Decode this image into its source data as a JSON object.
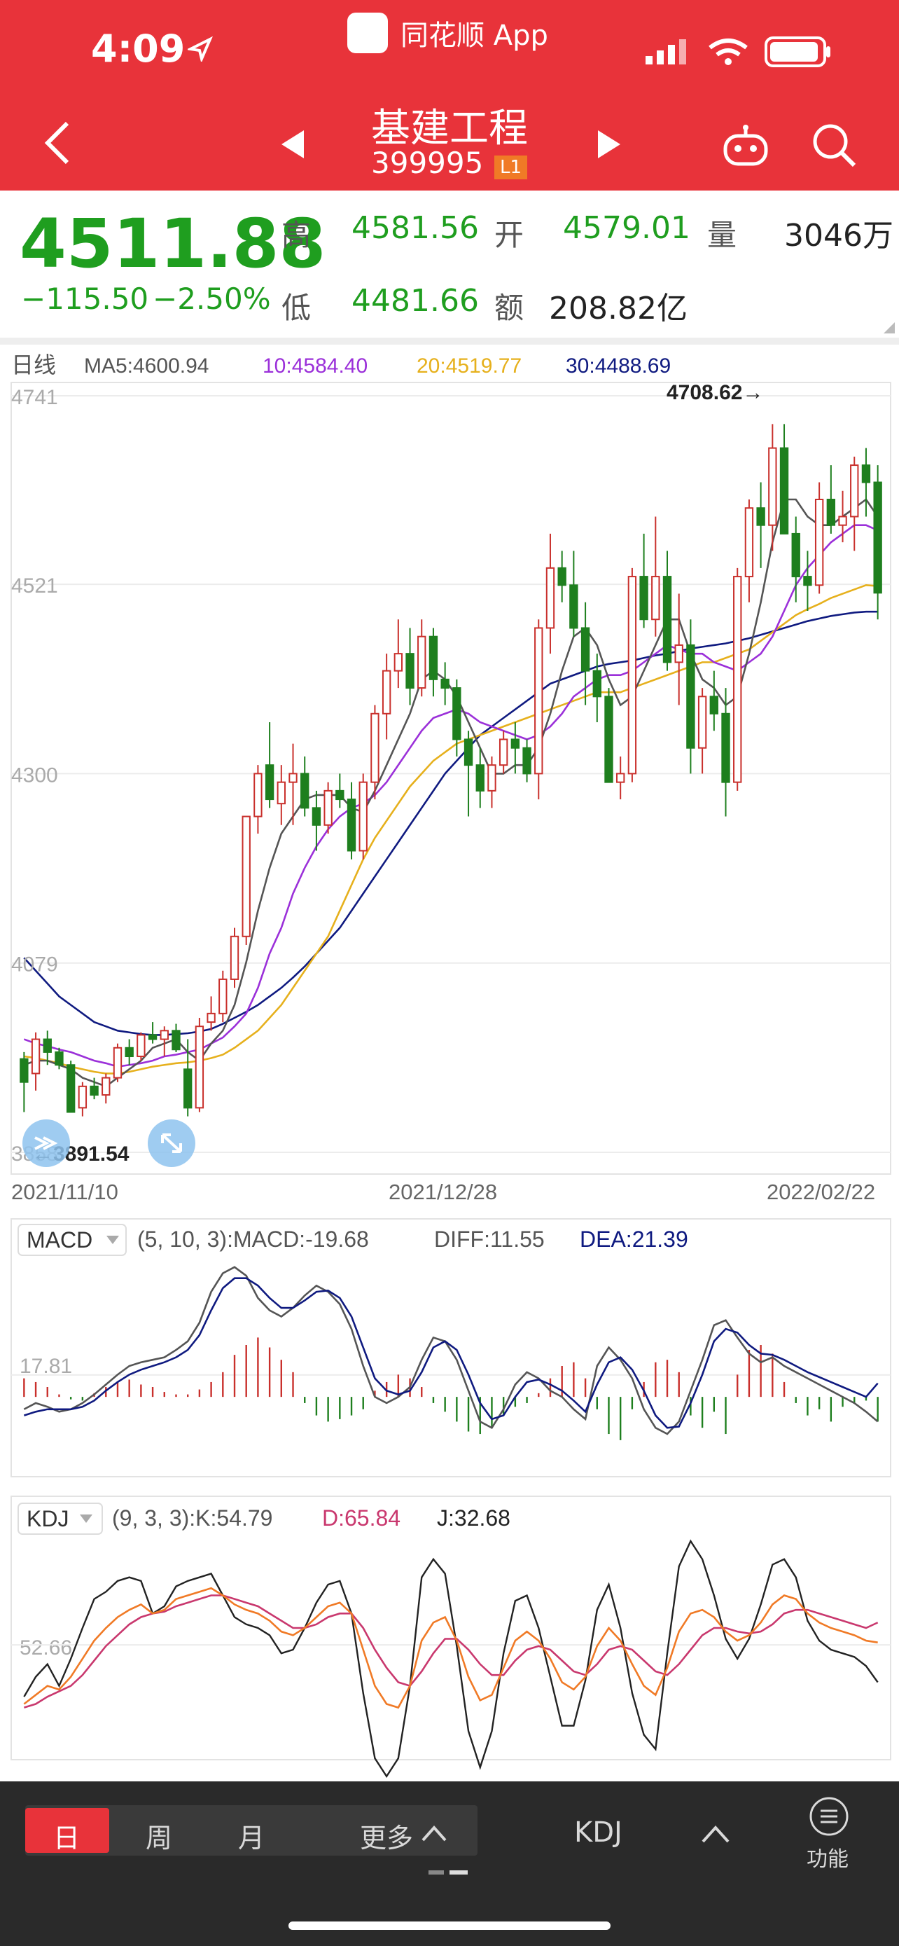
{
  "status": {
    "time": "4:09"
  },
  "app": {
    "name": "同花顺 App"
  },
  "nav": {
    "title": "基建工程",
    "code": "399995",
    "badge": "L1"
  },
  "quote": {
    "price": "4511.88",
    "change": "−115.50",
    "change_pct": "−2.50%",
    "high_label": "高",
    "high": "4581.56",
    "open_label": "开",
    "open": "4579.01",
    "volume_label": "量",
    "volume": "3046万",
    "low_label": "低",
    "low": "4481.66",
    "amount_label": "额",
    "amount": "208.82亿"
  },
  "colors": {
    "up": "#c9302c",
    "down": "#1e7f1e",
    "ma5": "#555555",
    "ma10": "#9b30d9",
    "ma20": "#e6b01c",
    "ma30": "#0f1a80",
    "brand": "#e8333a"
  },
  "ma_legend": {
    "period": "日线",
    "ma5": "MA5:4600.94",
    "ma10": "10:4584.40",
    "ma20": "20:4519.77",
    "ma30": "30:4488.69"
  },
  "chart_data": [
    {
      "type": "candlestick",
      "title": "基建工程",
      "y_ticks": [
        "4741",
        "4521",
        "4300",
        "4079",
        "3858"
      ],
      "ylim": [
        3858,
        4741
      ],
      "x_ticks": [
        "2021/11/10",
        "2021/12/28",
        "2022/02/22"
      ],
      "max_annotation": "4708.62→",
      "min_annotation": "←3891.54",
      "grid": true,
      "candles": [
        [
          3967,
          3975,
          3905,
          3940
        ],
        [
          3950,
          3998,
          3930,
          3990
        ],
        [
          3990,
          4000,
          3960,
          3975
        ],
        [
          3975,
          3980,
          3955,
          3960
        ],
        [
          3960,
          3965,
          3910,
          3905
        ],
        [
          3910,
          3940,
          3900,
          3935
        ],
        [
          3935,
          3945,
          3920,
          3925
        ],
        [
          3925,
          3950,
          3915,
          3945
        ],
        [
          3945,
          3985,
          3940,
          3980
        ],
        [
          3980,
          3990,
          3960,
          3970
        ],
        [
          3970,
          3998,
          3965,
          3995
        ],
        [
          3995,
          4010,
          3985,
          3990
        ],
        [
          3990,
          4005,
          3970,
          4000
        ],
        [
          4000,
          4008,
          3975,
          3978
        ],
        [
          3955,
          3990,
          3900,
          3910
        ],
        [
          3910,
          4015,
          3905,
          4005
        ],
        [
          4010,
          4040,
          4000,
          4020
        ],
        [
          4020,
          4070,
          4010,
          4060
        ],
        [
          4060,
          4120,
          4050,
          4110
        ],
        [
          4110,
          4230,
          4100,
          4250
        ],
        [
          4250,
          4310,
          4230,
          4300
        ],
        [
          4310,
          4360,
          4260,
          4270
        ],
        [
          4265,
          4310,
          4240,
          4290
        ],
        [
          4290,
          4335,
          4240,
          4300
        ],
        [
          4300,
          4320,
          4250,
          4260
        ],
        [
          4260,
          4280,
          4210,
          4240
        ],
        [
          4240,
          4290,
          4230,
          4280
        ],
        [
          4280,
          4300,
          4260,
          4270
        ],
        [
          4270,
          4290,
          4200,
          4210
        ],
        [
          4210,
          4300,
          4200,
          4290
        ],
        [
          4290,
          4380,
          4270,
          4370
        ],
        [
          4370,
          4440,
          4340,
          4420
        ],
        [
          4420,
          4480,
          4400,
          4440
        ],
        [
          4440,
          4470,
          4380,
          4400
        ],
        [
          4400,
          4480,
          4390,
          4460
        ],
        [
          4460,
          4470,
          4390,
          4410
        ],
        [
          4410,
          4430,
          4380,
          4400
        ],
        [
          4400,
          4410,
          4320,
          4340
        ],
        [
          4340,
          4350,
          4250,
          4310
        ],
        [
          4310,
          4330,
          4260,
          4280
        ],
        [
          4280,
          4320,
          4260,
          4310
        ],
        [
          4310,
          4350,
          4300,
          4340
        ],
        [
          4340,
          4360,
          4300,
          4330
        ],
        [
          4330,
          4340,
          4290,
          4300
        ],
        [
          4300,
          4480,
          4270,
          4470
        ],
        [
          4470,
          4580,
          4440,
          4540
        ],
        [
          4540,
          4560,
          4500,
          4520
        ],
        [
          4520,
          4560,
          4460,
          4470
        ],
        [
          4470,
          4500,
          4380,
          4420
        ],
        [
          4420,
          4440,
          4360,
          4390
        ],
        [
          4390,
          4400,
          4300,
          4290
        ],
        [
          4290,
          4320,
          4270,
          4300
        ],
        [
          4300,
          4540,
          4290,
          4530
        ],
        [
          4530,
          4580,
          4470,
          4480
        ],
        [
          4480,
          4600,
          4460,
          4530
        ],
        [
          4530,
          4560,
          4420,
          4430
        ],
        [
          4430,
          4510,
          4380,
          4450
        ],
        [
          4450,
          4480,
          4300,
          4330
        ],
        [
          4330,
          4400,
          4300,
          4390
        ],
        [
          4390,
          4420,
          4350,
          4370
        ],
        [
          4370,
          4400,
          4250,
          4290
        ],
        [
          4290,
          4540,
          4280,
          4530
        ],
        [
          4530,
          4620,
          4500,
          4610
        ],
        [
          4610,
          4640,
          4540,
          4590
        ],
        [
          4590,
          4708,
          4560,
          4680
        ],
        [
          4680,
          4708,
          4580,
          4580
        ],
        [
          4580,
          4600,
          4500,
          4530
        ],
        [
          4530,
          4560,
          4490,
          4520
        ],
        [
          4520,
          4640,
          4510,
          4620
        ],
        [
          4620,
          4660,
          4580,
          4590
        ],
        [
          4590,
          4630,
          4570,
          4600
        ],
        [
          4600,
          4670,
          4560,
          4660
        ],
        [
          4660,
          4680,
          4600,
          4640
        ],
        [
          4640,
          4660,
          4480,
          4511
        ]
      ],
      "ma5": [
        3960,
        3965,
        3965,
        3960,
        3955,
        3945,
        3940,
        3935,
        3945,
        3955,
        3965,
        3980,
        3985,
        3990,
        3975,
        3965,
        3985,
        4000,
        4030,
        4080,
        4140,
        4190,
        4230,
        4250,
        4270,
        4275,
        4275,
        4275,
        4260,
        4255,
        4280,
        4310,
        4340,
        4370,
        4410,
        4420,
        4410,
        4390,
        4360,
        4330,
        4300,
        4300,
        4310,
        4310,
        4330,
        4370,
        4420,
        4460,
        4470,
        4450,
        4410,
        4380,
        4390,
        4420,
        4450,
        4480,
        4480,
        4440,
        4410,
        4400,
        4380,
        4390,
        4440,
        4500,
        4570,
        4620,
        4620,
        4600,
        4590,
        4590,
        4600,
        4610,
        4620,
        4600
      ],
      "ma10": [
        3990,
        3985,
        3982,
        3978,
        3975,
        3970,
        3965,
        3962,
        3958,
        3960,
        3962,
        3965,
        3970,
        3972,
        3975,
        3978,
        3985,
        3992,
        4005,
        4020,
        4050,
        4090,
        4120,
        4160,
        4190,
        4215,
        4235,
        4250,
        4260,
        4265,
        4275,
        4290,
        4310,
        4330,
        4350,
        4365,
        4370,
        4375,
        4370,
        4360,
        4355,
        4350,
        4345,
        4340,
        4345,
        4355,
        4370,
        4390,
        4400,
        4410,
        4415,
        4415,
        4420,
        4430,
        4440,
        4450,
        4445,
        4440,
        4440,
        4430,
        4425,
        4420,
        4430,
        4440,
        4460,
        4490,
        4520,
        4540,
        4555,
        4570,
        4580,
        4590,
        4590,
        4584
      ],
      "ma20": [
        3970,
        3968,
        3965,
        3962,
        3958,
        3955,
        3952,
        3950,
        3950,
        3952,
        3955,
        3958,
        3960,
        3962,
        3963,
        3965,
        3968,
        3972,
        3980,
        3990,
        4000,
        4015,
        4030,
        4050,
        4070,
        4090,
        4110,
        4140,
        4170,
        4200,
        4225,
        4245,
        4265,
        4285,
        4300,
        4315,
        4325,
        4335,
        4340,
        4345,
        4350,
        4355,
        4360,
        4365,
        4370,
        4375,
        4380,
        4385,
        4390,
        4395,
        4395,
        4395,
        4400,
        4405,
        4410,
        4415,
        4420,
        4425,
        4430,
        4430,
        4435,
        4440,
        4445,
        4455,
        4465,
        4475,
        4485,
        4492,
        4498,
        4505,
        4510,
        4515,
        4520,
        4519
      ],
      "ma30": [
        4085,
        4070,
        4055,
        4040,
        4030,
        4020,
        4010,
        4005,
        4000,
        3998,
        3996,
        3995,
        3995,
        3996,
        3997,
        3999,
        4002,
        4008,
        4015,
        4022,
        4030,
        4040,
        4050,
        4062,
        4075,
        4090,
        4105,
        4120,
        4140,
        4160,
        4180,
        4200,
        4220,
        4240,
        4260,
        4280,
        4300,
        4315,
        4330,
        4345,
        4355,
        4365,
        4375,
        4385,
        4395,
        4405,
        4410,
        4415,
        4420,
        4425,
        4428,
        4430,
        4432,
        4435,
        4438,
        4440,
        4443,
        4446,
        4448,
        4450,
        4452,
        4455,
        4458,
        4462,
        4466,
        4470,
        4474,
        4478,
        4481,
        4484,
        4486,
        4488,
        4489,
        4489
      ]
    },
    {
      "type": "bar",
      "title": "MACD",
      "params": "(5, 10, 3):MACD:-19.68",
      "diff_label": "DIFF:11.55",
      "dea_label": "DEA:21.39",
      "indicator_label": "MACD",
      "ref_tick": "17.81",
      "ylim": [
        -60,
        110
      ],
      "hist": [
        15,
        12,
        8,
        2,
        -2,
        -3,
        3,
        8,
        12,
        14,
        10,
        8,
        4,
        2,
        2,
        6,
        12,
        20,
        34,
        42,
        48,
        40,
        30,
        20,
        -5,
        -15,
        -20,
        -18,
        -15,
        -10,
        5,
        12,
        18,
        15,
        8,
        -5,
        -12,
        -20,
        -28,
        -30,
        -25,
        -15,
        -8,
        -5,
        3,
        15,
        25,
        28,
        15,
        -10,
        -30,
        -35,
        -10,
        12,
        28,
        30,
        20,
        -15,
        -25,
        -12,
        -30,
        18,
        38,
        42,
        35,
        12,
        -5,
        -15,
        -10,
        -20,
        -8,
        -5,
        -3,
        -20
      ],
      "diff": [
        -10,
        -5,
        -8,
        -12,
        -10,
        -5,
        2,
        10,
        18,
        25,
        28,
        30,
        32,
        38,
        45,
        60,
        85,
        100,
        105,
        98,
        80,
        70,
        65,
        72,
        82,
        90,
        85,
        75,
        55,
        25,
        0,
        -5,
        0,
        8,
        30,
        48,
        45,
        30,
        5,
        -20,
        -25,
        -10,
        10,
        20,
        15,
        5,
        0,
        -10,
        -18,
        25,
        40,
        30,
        15,
        -10,
        -25,
        -30,
        -20,
        5,
        30,
        58,
        62,
        48,
        35,
        28,
        32,
        25,
        20,
        15,
        10,
        5,
        0,
        -5,
        -12,
        -20
      ],
      "dea": [
        -15,
        -12,
        -10,
        -10,
        -10,
        -8,
        -3,
        5,
        12,
        18,
        22,
        25,
        28,
        32,
        38,
        50,
        70,
        88,
        96,
        96,
        90,
        80,
        72,
        72,
        78,
        85,
        86,
        80,
        65,
        40,
        15,
        5,
        2,
        5,
        20,
        40,
        45,
        38,
        18,
        -5,
        -18,
        -15,
        0,
        12,
        14,
        10,
        5,
        -3,
        -12,
        10,
        28,
        32,
        22,
        5,
        -15,
        -25,
        -24,
        -5,
        18,
        45,
        55,
        52,
        42,
        35,
        34,
        30,
        25,
        20,
        16,
        12,
        8,
        4,
        0,
        11
      ]
    },
    {
      "type": "line",
      "title": "KDJ",
      "params": "(9, 3, 3):K:54.79",
      "d_label": "D:65.84",
      "j_label": "J:32.68",
      "indicator_label": "KDJ",
      "ref_tick": "52.66",
      "ylim": [
        -10,
        110
      ],
      "k": [
        20,
        25,
        30,
        28,
        35,
        45,
        55,
        62,
        68,
        72,
        75,
        70,
        72,
        78,
        80,
        82,
        84,
        80,
        75,
        72,
        70,
        66,
        60,
        58,
        62,
        68,
        74,
        76,
        70,
        50,
        30,
        20,
        18,
        30,
        55,
        65,
        68,
        55,
        35,
        22,
        25,
        40,
        55,
        60,
        55,
        45,
        32,
        28,
        35,
        52,
        62,
        55,
        42,
        30,
        25,
        40,
        60,
        70,
        72,
        68,
        60,
        55,
        58,
        65,
        75,
        80,
        78,
        70,
        65,
        62,
        60,
        58,
        55,
        54
      ],
      "d": [
        18,
        20,
        24,
        27,
        30,
        36,
        44,
        52,
        58,
        64,
        68,
        70,
        71,
        74,
        76,
        78,
        80,
        80,
        78,
        76,
        74,
        70,
        66,
        62,
        62,
        64,
        68,
        70,
        70,
        62,
        50,
        40,
        32,
        30,
        38,
        48,
        56,
        56,
        50,
        42,
        36,
        36,
        44,
        50,
        52,
        50,
        44,
        38,
        36,
        42,
        50,
        52,
        50,
        44,
        38,
        36,
        42,
        50,
        58,
        62,
        62,
        60,
        59,
        60,
        64,
        70,
        72,
        72,
        70,
        68,
        66,
        64,
        62,
        65
      ],
      "j": [
        24,
        35,
        42,
        30,
        45,
        62,
        78,
        82,
        88,
        90,
        88,
        70,
        74,
        85,
        88,
        90,
        92,
        80,
        68,
        64,
        62,
        58,
        48,
        50,
        62,
        76,
        86,
        88,
        70,
        26,
        -10,
        -20,
        -10,
        30,
        90,
        100,
        92,
        52,
        5,
        -15,
        5,
        48,
        77,
        80,
        62,
        35,
        8,
        8,
        33,
        72,
        86,
        62,
        26,
        3,
        -5,
        48,
        96,
        110,
        100,
        80,
        56,
        45,
        56,
        75,
        97,
        100,
        90,
        66,
        55,
        50,
        48,
        46,
        41,
        32
      ]
    }
  ],
  "bottom": {
    "tabs": [
      "日",
      "周",
      "月"
    ],
    "more": "更多",
    "indicator": "KDJ",
    "function_label": "功能"
  }
}
